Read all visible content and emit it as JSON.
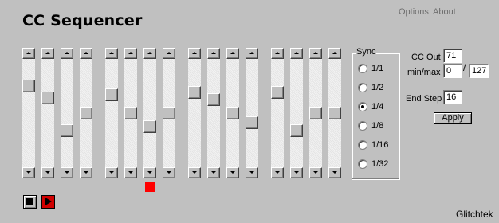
{
  "app": {
    "title": "CC Sequencer",
    "brand": "Glitchtek"
  },
  "menu": {
    "options": "Options",
    "about": "About"
  },
  "steps": [
    {
      "value": 0.78
    },
    {
      "value": 0.66
    },
    {
      "value": 0.32
    },
    {
      "value": 0.5
    },
    {
      "value": 0.69
    },
    {
      "value": 0.5
    },
    {
      "value": 0.36
    },
    {
      "value": 0.5
    },
    {
      "value": 0.72
    },
    {
      "value": 0.64
    },
    {
      "value": 0.5
    },
    {
      "value": 0.4
    },
    {
      "value": 0.72
    },
    {
      "value": 0.32
    },
    {
      "value": 0.5
    },
    {
      "value": 0.5
    }
  ],
  "current_step": 7,
  "sync": {
    "legend": "Sync",
    "options": [
      "1/1",
      "1/2",
      "1/4",
      "1/8",
      "1/16",
      "1/32"
    ],
    "selected": "1/4"
  },
  "controls": {
    "cc_out_label": "CC Out",
    "cc_out_value": "71",
    "minmax_label": "min/max",
    "min_value": "0",
    "slash": "/",
    "max_value": "127",
    "end_step_label": "End Step",
    "end_step_value": "16",
    "apply_label": "Apply"
  },
  "colors": {
    "background": "#c0c0c0",
    "step_indicator": "#ff0000",
    "play_button": "#d00000"
  }
}
